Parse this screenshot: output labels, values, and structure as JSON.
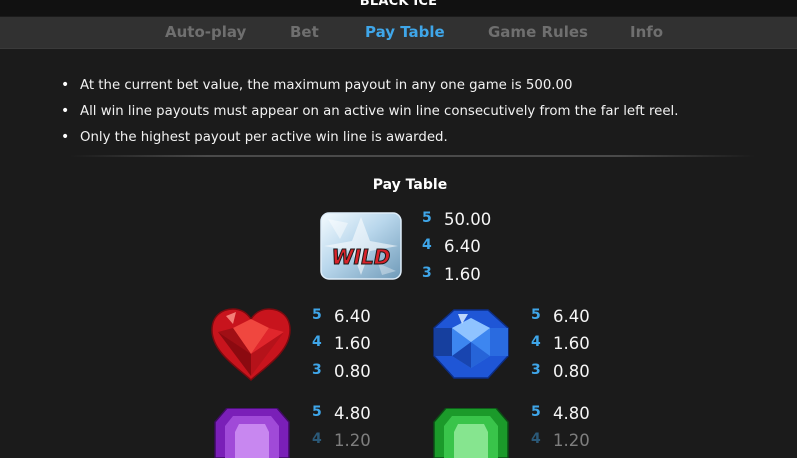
{
  "window": {
    "title": "BLACK ICE"
  },
  "tabs": [
    {
      "label": "Auto-play",
      "active": false
    },
    {
      "label": "Bet",
      "active": false
    },
    {
      "label": "Pay Table",
      "active": true
    },
    {
      "label": "Game Rules",
      "active": false
    },
    {
      "label": "Info",
      "active": false
    }
  ],
  "rules": [
    "At the current bet value, the maximum payout in any one game is 500.00",
    "All win line payouts must appear on an active win line consecutively from the far left reel.",
    "Only the highest payout per active win line is awarded."
  ],
  "paytable": {
    "heading": "Pay Table",
    "wild_text": "WILD",
    "symbols": [
      {
        "name": "wild",
        "payouts": [
          {
            "count": "5",
            "value": "50.00"
          },
          {
            "count": "4",
            "value": "6.40"
          },
          {
            "count": "3",
            "value": "1.60"
          }
        ]
      },
      {
        "name": "red-heart-gem",
        "payouts": [
          {
            "count": "5",
            "value": "6.40"
          },
          {
            "count": "4",
            "value": "1.60"
          },
          {
            "count": "3",
            "value": "0.80"
          }
        ]
      },
      {
        "name": "blue-round-gem",
        "payouts": [
          {
            "count": "5",
            "value": "6.40"
          },
          {
            "count": "4",
            "value": "1.60"
          },
          {
            "count": "3",
            "value": "0.80"
          }
        ]
      },
      {
        "name": "purple-emerald-gem",
        "payouts": [
          {
            "count": "5",
            "value": "4.80"
          },
          {
            "count": "4",
            "value": "1.20"
          }
        ]
      },
      {
        "name": "green-emerald-gem",
        "payouts": [
          {
            "count": "5",
            "value": "4.80"
          },
          {
            "count": "4",
            "value": "1.20"
          }
        ]
      }
    ]
  },
  "colors": {
    "accent": "#3fa6e9",
    "background": "#1b1b1b",
    "tab_bar": "#313131",
    "tab_inactive": "#6f6f6f"
  }
}
